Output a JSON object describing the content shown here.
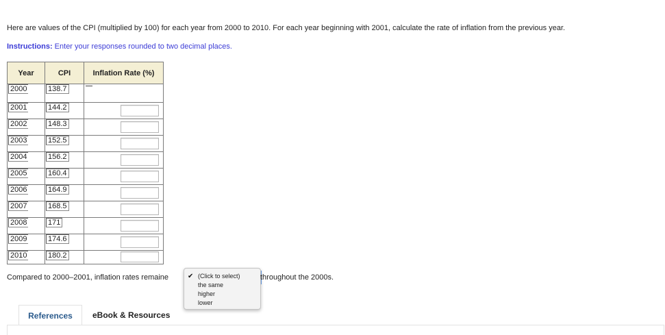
{
  "question_text": "Here are values of the CPI (multiplied by 100) for each year from 2000 to 2010. For each year beginning with 2001, calculate the rate of inflation from the previous year.",
  "instructions": {
    "label": "Instructions:",
    "text": " Enter your responses rounded to two decimal places."
  },
  "table": {
    "headers": [
      "Year",
      "CPI",
      "Inflation Rate (%)"
    ],
    "rows": [
      {
        "year": "2000",
        "cpi": "138.7",
        "rate": "",
        "has_input": false
      },
      {
        "year": "2001",
        "cpi": "144.2",
        "rate": "",
        "has_input": true
      },
      {
        "year": "2002",
        "cpi": "148.3",
        "rate": "",
        "has_input": true
      },
      {
        "year": "2003",
        "cpi": "152.5",
        "rate": "",
        "has_input": true
      },
      {
        "year": "2004",
        "cpi": "156.2",
        "rate": "",
        "has_input": true
      },
      {
        "year": "2005",
        "cpi": "160.4",
        "rate": "",
        "has_input": true
      },
      {
        "year": "2006",
        "cpi": "164.9",
        "rate": "",
        "has_input": true
      },
      {
        "year": "2007",
        "cpi": "168.5",
        "rate": "",
        "has_input": true
      },
      {
        "year": "2008",
        "cpi": "171",
        "rate": "",
        "has_input": true
      },
      {
        "year": "2009",
        "cpi": "174.6",
        "rate": "",
        "has_input": true
      },
      {
        "year": "2010",
        "cpi": "180.2",
        "rate": "",
        "has_input": true
      }
    ]
  },
  "sentence": {
    "before": "Compared to 2000–2001, inflation rates remaine",
    "after": "throughout the 2000s."
  },
  "dropdown": {
    "options": [
      "(Click to select)",
      "the same",
      "higher",
      "lower"
    ],
    "selected_index": 0
  },
  "tabs": {
    "references": "References",
    "ebook": "eBook & Resources"
  }
}
